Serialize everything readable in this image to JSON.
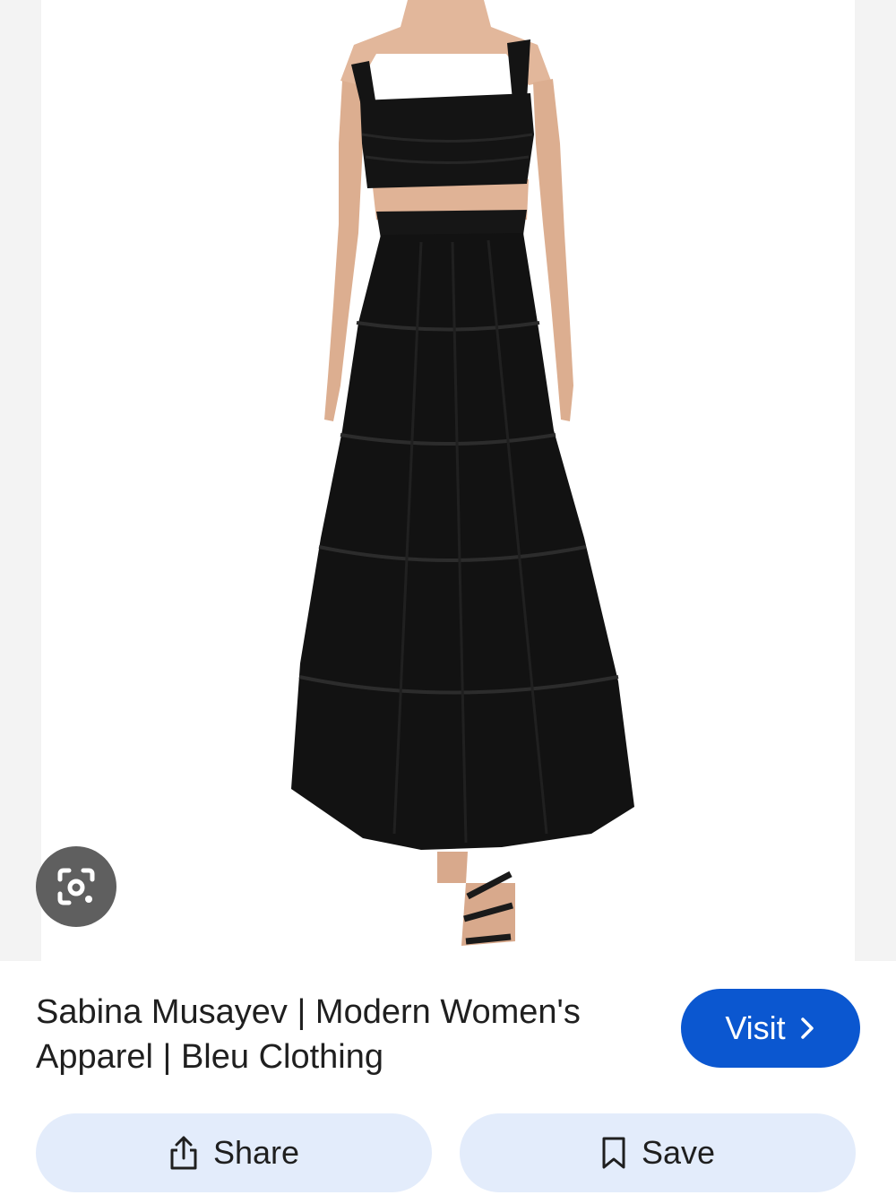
{
  "result": {
    "title": "Sabina Musayev | Modern Women's Apparel | Bleu Clothing"
  },
  "buttons": {
    "visit_label": "Visit",
    "share_label": "Share",
    "save_label": "Save"
  },
  "icons": {
    "lens": "google-lens-icon",
    "visit_arrow": "chevron-right-icon",
    "share": "share-icon",
    "save": "bookmark-icon"
  },
  "colors": {
    "visit_bg": "#0b57d0",
    "action_bg": "#e3ecfb",
    "lens_bg": "#5f5f5f"
  }
}
